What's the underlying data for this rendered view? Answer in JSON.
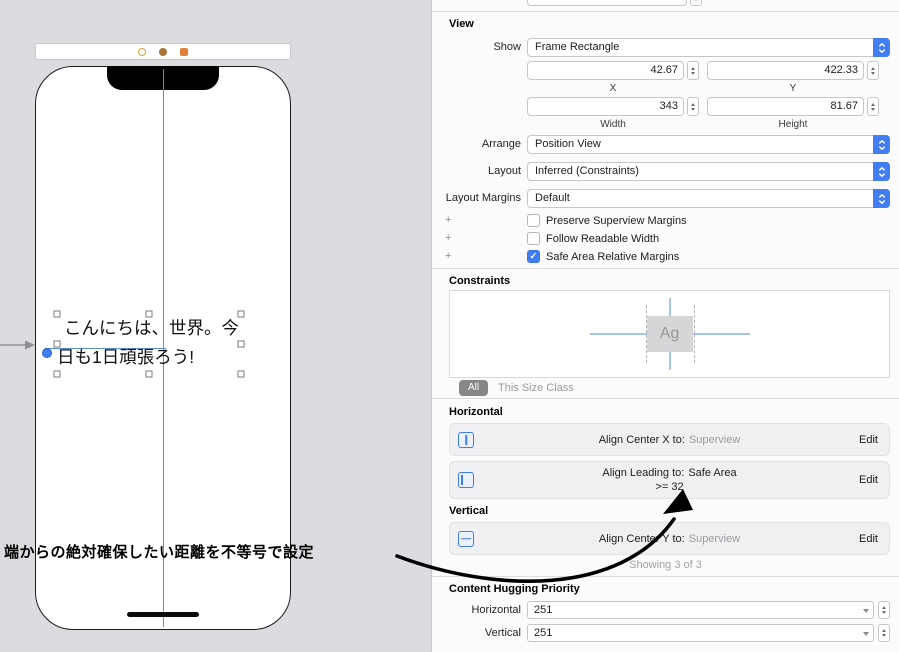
{
  "colors": {
    "accent_blue": "#3f7cf6",
    "guide_blue": "#5b8fd6",
    "canvas_bg": "#dbdcdf"
  },
  "icons": {
    "checkmark": "✓"
  },
  "canvas": {
    "annotation": "端からの絶対確保したい距離を不等号で設定",
    "label_line1": "こんにちは、世界。今",
    "label_line2": "日も1日頑張ろう!"
  },
  "inspector": {
    "view": {
      "title": "View",
      "show_label": "Show",
      "show_value": "Frame Rectangle",
      "x_value": "42.67",
      "x_label": "X",
      "y_value": "422.33",
      "y_label": "Y",
      "width_value": "343",
      "width_label": "Width",
      "height_value": "81.67",
      "height_label": "Height",
      "arrange_label": "Arrange",
      "arrange_value": "Position View",
      "layout_label": "Layout",
      "layout_value": "Inferred (Constraints)",
      "margins_label": "Layout Margins",
      "margins_value": "Default",
      "plus": "+",
      "checkboxes": [
        {
          "label": "Preserve Superview Margins",
          "checked": false
        },
        {
          "label": "Follow Readable Width",
          "checked": false
        },
        {
          "label": "Safe Area Relative Margins",
          "checked": true
        }
      ]
    },
    "constraints": {
      "title": "Constraints",
      "preview_glyph": "Ag",
      "all_badge": "All",
      "size_class": "This Size Class",
      "horizontal_title": "Horizontal",
      "vertical_title": "Vertical",
      "rows": [
        {
          "label": "Align Center X to:",
          "value": "Superview",
          "edit": "Edit"
        },
        {
          "label": "Align Leading to:",
          "value": "Safe Area",
          "relation": ">=  32",
          "edit": "Edit"
        },
        {
          "label": "Align Center Y to:",
          "value": "Superview",
          "edit": "Edit"
        }
      ],
      "showing": "Showing 3 of 3"
    },
    "hugging": {
      "title": "Content Hugging Priority",
      "horizontal_label": "Horizontal",
      "horizontal_value": "251",
      "vertical_label": "Vertical",
      "vertical_value": "251"
    }
  }
}
